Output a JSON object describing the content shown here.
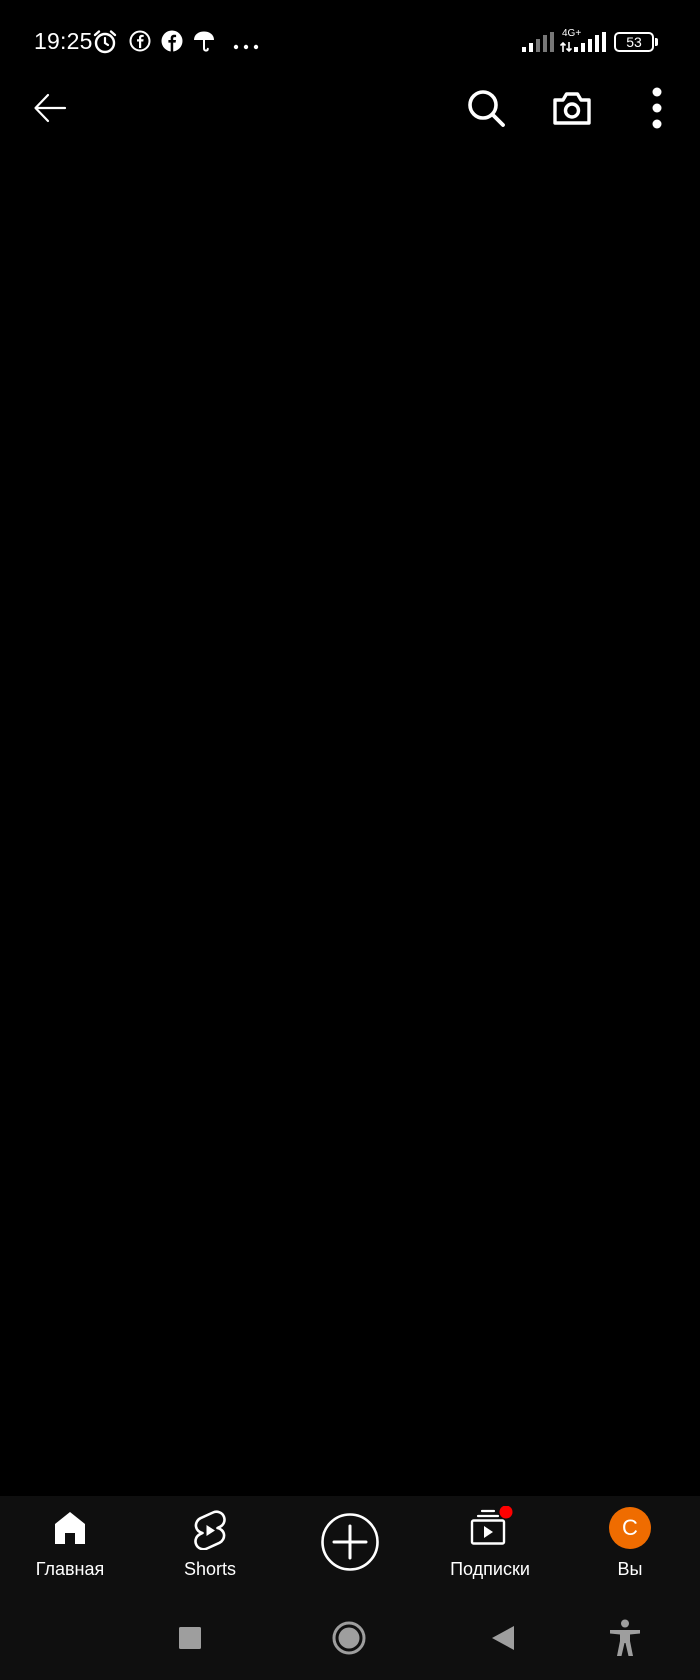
{
  "status_bar": {
    "time": "19:25",
    "network": "4G+",
    "battery": "53",
    "notification_icons": [
      "alarm-icon",
      "facebook-icon",
      "facebook-icon",
      "umbrella-icon",
      "more-dots-icon"
    ]
  },
  "top_bar": {
    "icons": [
      "back-arrow-icon",
      "search-icon",
      "camera-icon",
      "more-vert-icon"
    ]
  },
  "bottom_nav": {
    "items": [
      {
        "label": "Главная",
        "icon": "home-icon"
      },
      {
        "label": "Shorts",
        "icon": "shorts-icon"
      },
      {
        "label": "",
        "icon": "create-plus-icon"
      },
      {
        "label": "Подписки",
        "icon": "subscriptions-icon"
      },
      {
        "label": "Вы",
        "icon": "avatar"
      }
    ],
    "avatar_letter": "C",
    "avatar_color": "#ef6c00",
    "badge_color": "#ff0000"
  },
  "system_nav": {
    "icons": [
      "recents-square-icon",
      "home-circle-icon",
      "back-triangle-icon",
      "accessibility-icon"
    ]
  },
  "colors": {
    "background": "#000000",
    "nav_background": "#0f0f0f",
    "foreground": "#ffffff",
    "system_icon": "#9e9e9e"
  }
}
